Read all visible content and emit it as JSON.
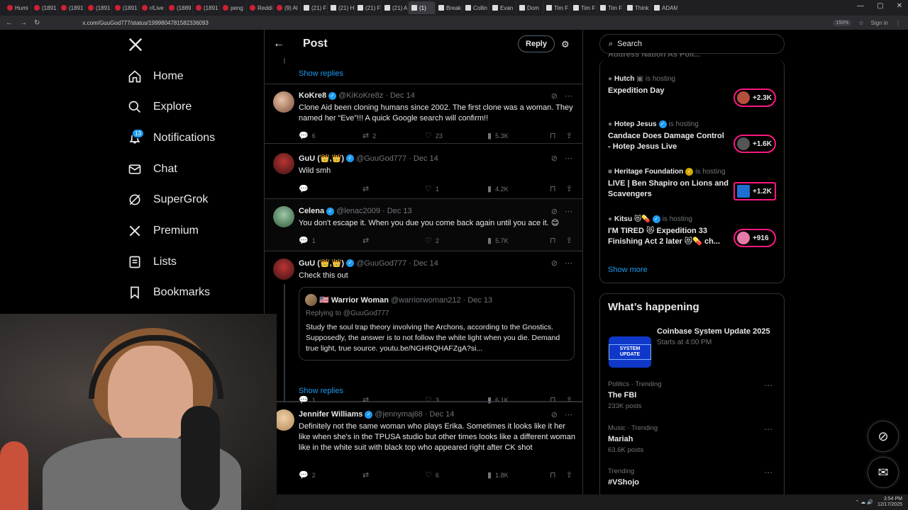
{
  "browser": {
    "tabs": [
      {
        "label": "Humi",
        "kind": "yt"
      },
      {
        "label": "(1891",
        "kind": "yt"
      },
      {
        "label": "(1891",
        "kind": "yt"
      },
      {
        "label": "(1891",
        "kind": "yt"
      },
      {
        "label": "(1891",
        "kind": "yt"
      },
      {
        "label": "r/Live",
        "kind": "yt"
      },
      {
        "label": "(1889",
        "kind": "yt"
      },
      {
        "label": "(1891",
        "kind": "yt"
      },
      {
        "label": "peng",
        "kind": "yt"
      },
      {
        "label": "Reddi",
        "kind": "yt"
      },
      {
        "label": "(9) Al",
        "kind": "yt"
      },
      {
        "label": "(21) F",
        "kind": "x"
      },
      {
        "label": "(21) H",
        "kind": "x"
      },
      {
        "label": "(21) F",
        "kind": "x"
      },
      {
        "label": "(21) A",
        "kind": "x"
      },
      {
        "label": "(1)",
        "kind": "x"
      },
      {
        "label": "Break",
        "kind": "x"
      },
      {
        "label": "Collin",
        "kind": "x"
      },
      {
        "label": "Evan",
        "kind": "x"
      },
      {
        "label": "Dom",
        "kind": "x"
      },
      {
        "label": "Tim F",
        "kind": "x"
      },
      {
        "label": "Tim F",
        "kind": "x"
      },
      {
        "label": "Tim F",
        "kind": "x"
      },
      {
        "label": "Think",
        "kind": "x"
      },
      {
        "label": "ADAM",
        "kind": "x"
      }
    ],
    "url": "x.com/GuuGod777/status/1999804781582336093",
    "zoom": "150%",
    "signin": "Sign in"
  },
  "nav": {
    "items": [
      {
        "label": "Home",
        "icon": "home-icon"
      },
      {
        "label": "Explore",
        "icon": "search-icon"
      },
      {
        "label": "Notifications",
        "icon": "bell-icon"
      },
      {
        "label": "Chat",
        "icon": "mail-icon"
      },
      {
        "label": "SuperGrok",
        "icon": "grok-icon"
      },
      {
        "label": "Premium",
        "icon": "x-logo-icon"
      },
      {
        "label": "Lists",
        "icon": "list-icon"
      },
      {
        "label": "Bookmarks",
        "icon": "bookmark-icon"
      }
    ],
    "notifications_badge": "13"
  },
  "header": {
    "title": "Post",
    "reply_label": "Reply"
  },
  "thread": {
    "show_replies_top": "Show replies",
    "show_replies_mid": "Show replies",
    "tweets": [
      {
        "name": "KoKre8",
        "handle": "@KiKoKre8z",
        "date": "· Dec 14",
        "body": "Clone Aid been cloning humans since 2002. The first clone was a woman. They named her “Eve”!!! A quick Google search will confirm!!",
        "replies": "6",
        "reposts": "2",
        "likes": "23",
        "views": "5.3K"
      },
      {
        "name": "GuU (👑,👑)",
        "handle": "@GuuGod777",
        "date": "· Dec 14",
        "body": "Wild smh",
        "replies": "",
        "reposts": "",
        "likes": "1",
        "views": "4.2K"
      },
      {
        "name": "Celena",
        "handle": "@lenac2009",
        "date": "· Dec 13",
        "body": "You don't escape it. When you due you come back again until you ace it. 😊",
        "replies": "1",
        "reposts": "",
        "likes": "2",
        "views": "5.7K"
      },
      {
        "name": "GuU (👑,👑)",
        "handle": "@GuuGod777",
        "date": "· Dec 14",
        "body": "Check this out",
        "replies": "1",
        "reposts": "",
        "likes": "3",
        "views": "6.1K",
        "quote": {
          "flag": "🇺🇸",
          "name": "Warrior Woman",
          "handle": "@warriorwoman212",
          "date": "· Dec 13",
          "replying": "Replying to @GuuGod777",
          "body": "Study the soul trap theory involving the Archons, according to the Gnostics. Supposedly, the answer is to not follow the white light when you die. Demand true light, true source. youtu.be/NGHRQHAFZgA?si..."
        }
      },
      {
        "name": "Jennifer Williams",
        "handle": "@jennymaj68",
        "date": "· Dec 14",
        "body": "Definitely not the same woman who plays Erika. Sometimes it looks like it her like when she's in the TPUSA studio but other times looks like a different woman like in the white suit with black top who appeared right after CK shot",
        "replies": "2",
        "reposts": "",
        "likes": "6",
        "views": "1.8K"
      }
    ]
  },
  "right": {
    "search_placeholder": "Search",
    "live_partial_title": "Address Nation As Poli...",
    "lives": [
      {
        "host": "Hutch",
        "hosting": "is hosting",
        "title": "Expedition Day",
        "count": "+2.3K",
        "color": "#b5503c"
      },
      {
        "host": "Hotep Jesus",
        "hosting": "is hosting",
        "title": "Candace Does Damage Control - Hotep Jesus Live",
        "count": "+1.6K",
        "color": "#555555"
      },
      {
        "host": "Heritage Foundation",
        "hosting": "is hosting",
        "title": "LIVE | Ben Shapiro on Lions and Scavengers",
        "count": "+1.2K",
        "color": "#1d6fd1"
      },
      {
        "host": "Kitsu 😻💊",
        "hosting": "is hosting",
        "title": "I'M TIRED 😻 Expedition 33 Finishing Act 2 later 😻💊 ch...",
        "count": "+916",
        "color": "#e67aa8"
      }
    ],
    "show_more": "Show more",
    "happening": {
      "title": "What’s happening",
      "featured": {
        "title": "Coinbase System Update 2025",
        "sub": "Starts at 4:00 PM",
        "thumb": "SYSTEM UPDATE"
      },
      "trends": [
        {
          "cat": "Politics · Trending",
          "name": "The FBI",
          "count": "233K posts"
        },
        {
          "cat": "Music · Trending",
          "name": "Mariah",
          "count": "63.6K posts"
        },
        {
          "cat": "Trending",
          "name": "#VShojo",
          "count": ""
        }
      ]
    }
  },
  "taskbar": {
    "time": "3:54 PM",
    "date": "12/17/2025"
  }
}
